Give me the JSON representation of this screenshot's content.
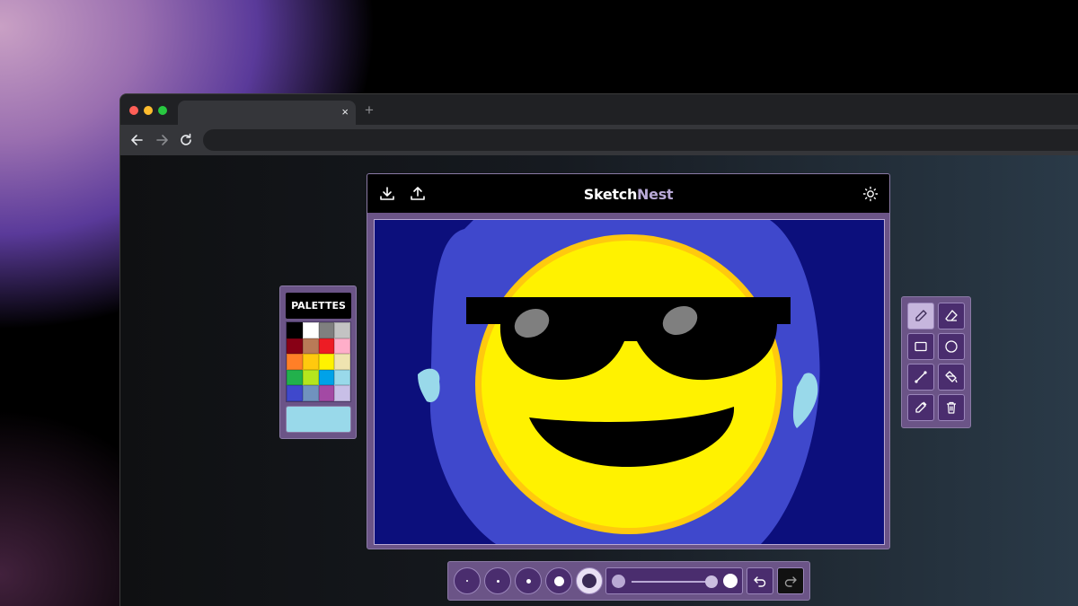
{
  "browser": {
    "tab_close": "×",
    "tab_new": "+"
  },
  "app": {
    "title_part1": "Sketch",
    "title_part2": "Nest",
    "title_part2_color": "#b8a9d6"
  },
  "palette": {
    "title": "PALETTES",
    "colors": [
      "#000000",
      "#ffffff",
      "#7f7f7f",
      "#c3c3c3",
      "#880015",
      "#b97a57",
      "#ed1c24",
      "#ffaec9",
      "#ff7f27",
      "#ffc90e",
      "#fff200",
      "#efe4b0",
      "#22b14c",
      "#b5e61d",
      "#00a2e8",
      "#99d9ea",
      "#3f48cc",
      "#7092be",
      "#a349a4",
      "#c8bfe7"
    ],
    "current_color": "#99d9ea"
  },
  "tools": {
    "items": [
      {
        "name": "pencil",
        "active": true
      },
      {
        "name": "eraser",
        "active": false
      },
      {
        "name": "rectangle",
        "active": false
      },
      {
        "name": "circle",
        "active": false
      },
      {
        "name": "line",
        "active": false
      },
      {
        "name": "fill-bucket",
        "active": false
      },
      {
        "name": "color-picker",
        "active": false
      },
      {
        "name": "trash",
        "active": false
      }
    ]
  },
  "brush": {
    "sizes": [
      1,
      2,
      3,
      4,
      5
    ],
    "selected_size": 5,
    "slider_value": 0.9
  },
  "canvas": {
    "background": "#0c0f7c",
    "accent_colors": [
      "#3f48cc",
      "#fff200",
      "#000000",
      "#7f7f7f",
      "#99d9ea",
      "#ffc90e"
    ]
  }
}
